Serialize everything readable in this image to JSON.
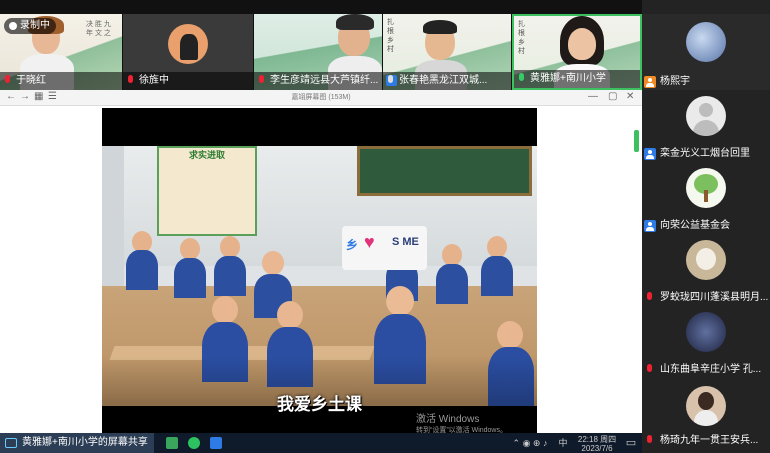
{
  "recording": {
    "label": "录制中"
  },
  "top_tiles": [
    {
      "name": "于晓红",
      "mic": "red"
    },
    {
      "name": "徐旌中",
      "mic": "red"
    },
    {
      "name": "李生彦靖远县大芦镇纤...",
      "mic": "red"
    },
    {
      "name": "张春艳黑龙江双城...",
      "mic": "blue"
    },
    {
      "name": "黄雅娜+南川小学",
      "mic": "green"
    }
  ],
  "side_tiles": [
    {
      "name": "杨熙宇",
      "icon": "user-orange"
    },
    {
      "name": "栾金光义工烟台回里",
      "icon": "user-blue"
    },
    {
      "name": "向荣公益基金会",
      "icon": "user-blue"
    },
    {
      "name": "罗蛟珑四川蓬溪县明月...",
      "icon": "mic-red"
    },
    {
      "name": "山东曲阜辛庄小学  孔...",
      "icon": "mic-red"
    },
    {
      "name": "杨琦九年一贯王安兵...",
      "icon": "mic-red"
    }
  ],
  "player": {
    "title": "嘉翊屏幕图 (153M)",
    "subtitle": "我爱乡土课",
    "board_text": "求实进取",
    "sign_letters": "S ME",
    "sign_left": "乡",
    "activation_line1": "激活 Windows",
    "activation_line2": "转到“设置”以激活 Windows。"
  },
  "taskbar": {
    "share_label": "黄雅娜+南川小学的屏幕共享",
    "time": "22:18 周四",
    "date": "2023/7/6",
    "lang": "中"
  },
  "colors": {
    "accent": "#2e7be6",
    "mic_active": "#3cc060",
    "mic_muted": "#e02233",
    "active_border": "#3cc060"
  }
}
